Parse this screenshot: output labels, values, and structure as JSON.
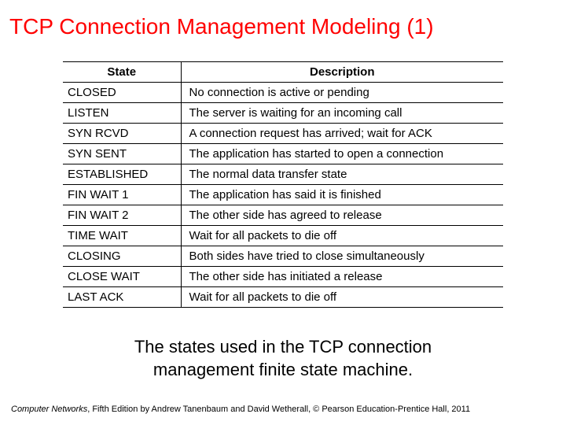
{
  "title": "TCP Connection Management Modeling (1)",
  "table": {
    "headers": {
      "state": "State",
      "description": "Description"
    },
    "rows": [
      {
        "state": "CLOSED",
        "description": "No connection is active or pending"
      },
      {
        "state": "LISTEN",
        "description": "The server is waiting for an incoming call"
      },
      {
        "state": "SYN RCVD",
        "description": "A connection request has arrived; wait for ACK"
      },
      {
        "state": "SYN SENT",
        "description": "The application has started to open a connection"
      },
      {
        "state": "ESTABLISHED",
        "description": "The normal data transfer state"
      },
      {
        "state": "FIN WAIT 1",
        "description": "The application has said it is finished"
      },
      {
        "state": "FIN WAIT 2",
        "description": "The other side has agreed to release"
      },
      {
        "state": "TIME WAIT",
        "description": "Wait for all packets to die off"
      },
      {
        "state": "CLOSING",
        "description": "Both sides have tried to close simultaneously"
      },
      {
        "state": "CLOSE WAIT",
        "description": "The other side has initiated a release"
      },
      {
        "state": "LAST ACK",
        "description": "Wait for all packets to die off"
      }
    ]
  },
  "caption_line1": "The states used in the TCP connection",
  "caption_line2": "management finite state machine.",
  "footer": {
    "book_title": "Computer Networks",
    "rest": ", Fifth Edition by Andrew Tanenbaum and David Wetherall, © Pearson Education-Prentice Hall, 2011"
  }
}
